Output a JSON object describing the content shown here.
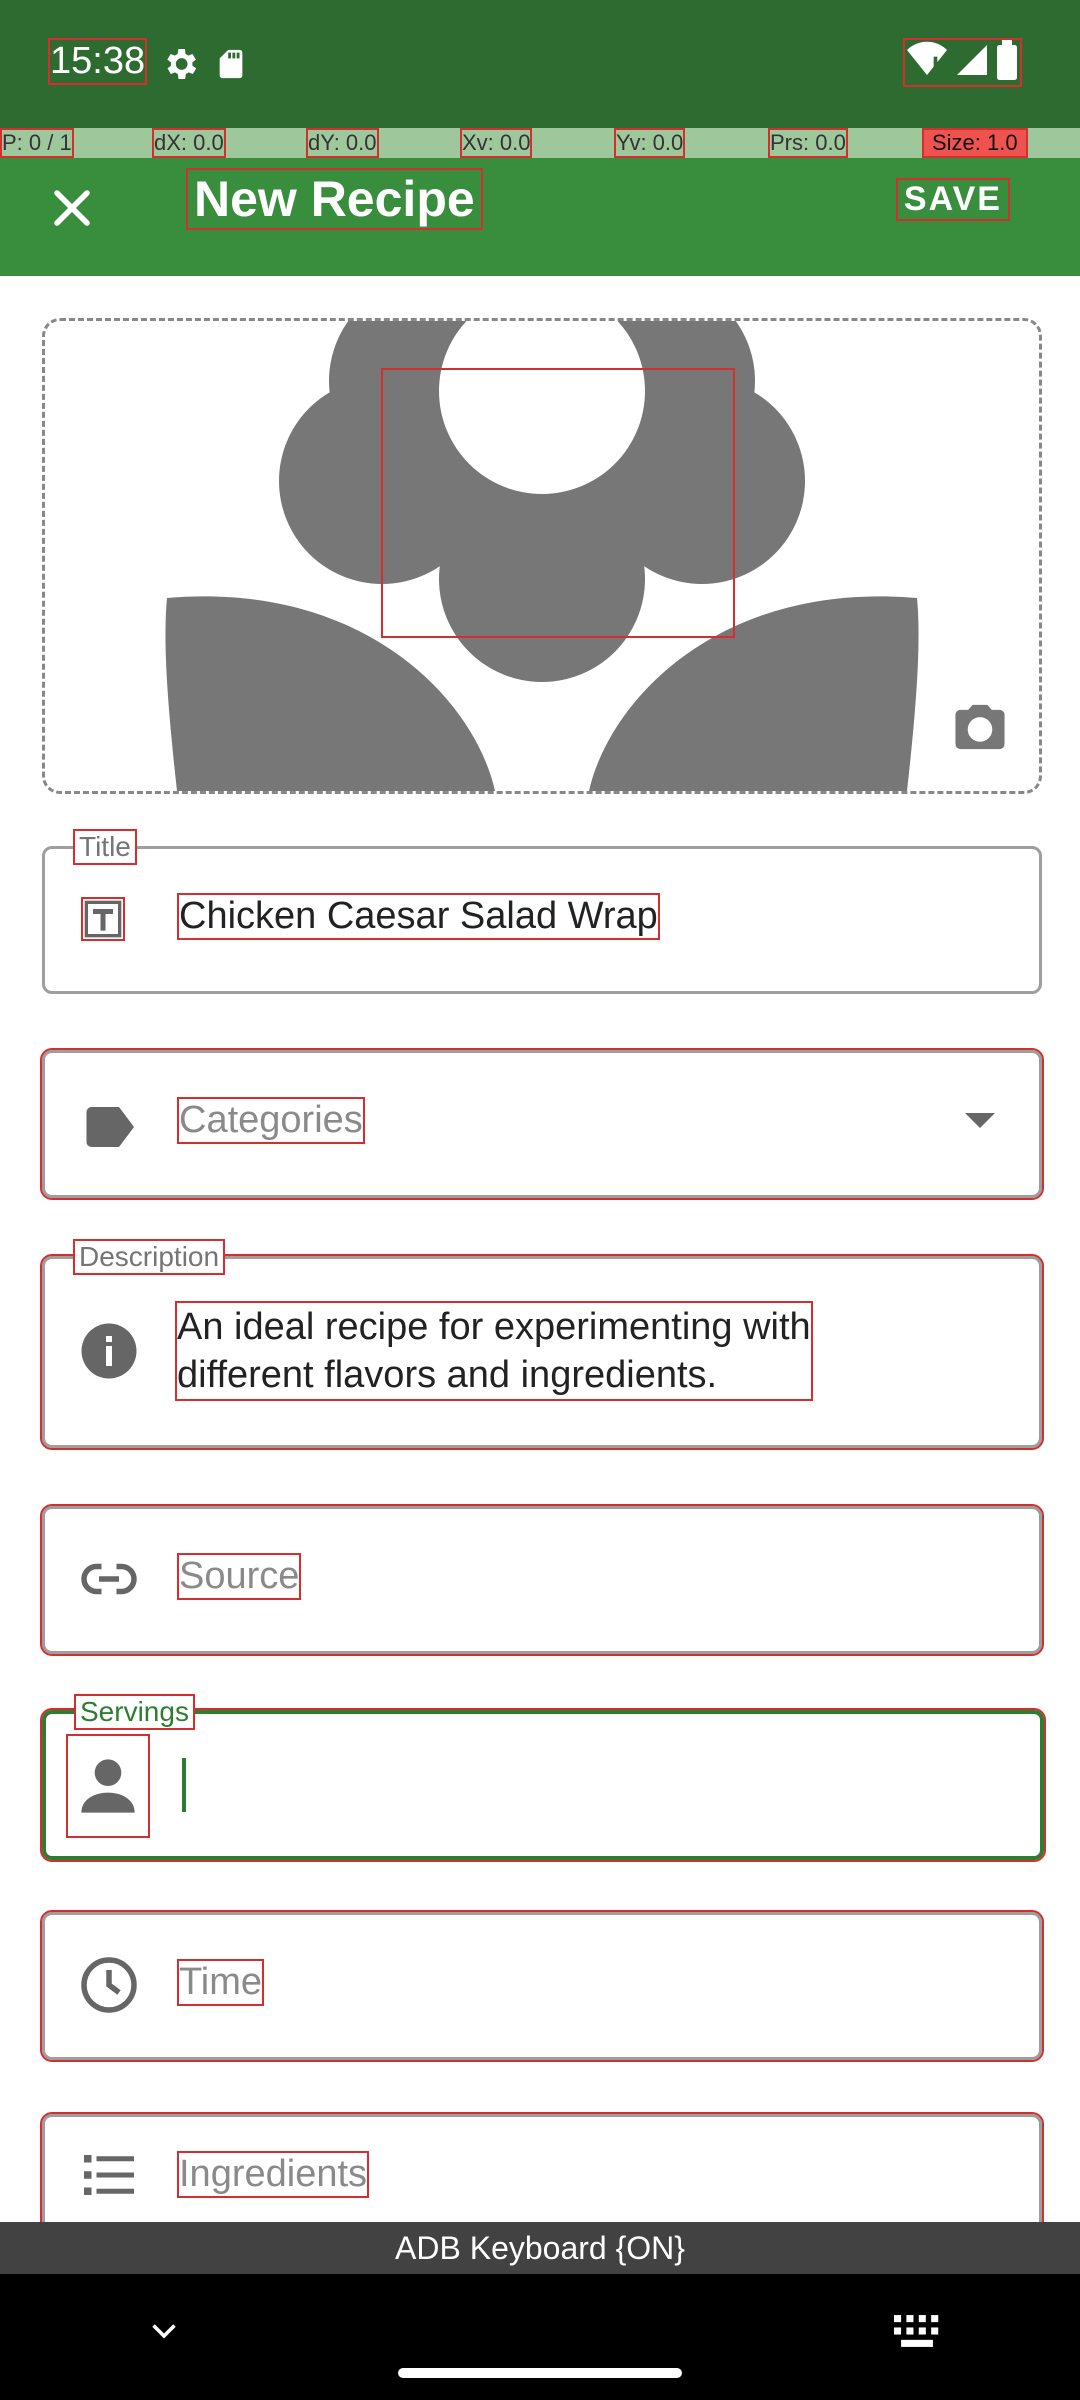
{
  "status_bar": {
    "time": "15:38",
    "left_icons": [
      "settings-icon",
      "sd-card-icon"
    ],
    "right_icons": [
      "wifi-alert-icon",
      "signal-icon",
      "battery-icon"
    ]
  },
  "dev_overlay": {
    "p": "P: 0 / 1",
    "dx": "dX: 0.0",
    "dy": "dY: 0.0",
    "xv": "Xv: 0.0",
    "yv": "Yv: 0.0",
    "prs": "Prs: 0.0",
    "size": "Size: 1.0"
  },
  "app_bar": {
    "title": "New Recipe",
    "save_label": "SAVE",
    "close_icon": "close-icon",
    "color": "#388e3c"
  },
  "form": {
    "title": {
      "label": "Title",
      "value": "Chicken Caesar Salad Wrap"
    },
    "categories": {
      "placeholder": "Categories"
    },
    "description": {
      "label": "Description",
      "value_line1": "An ideal recipe for experimenting with",
      "value_line2": "different flavors and ingredients."
    },
    "source": {
      "placeholder": "Source"
    },
    "servings": {
      "label": "Servings",
      "value": ""
    },
    "time": {
      "placeholder": "Time"
    },
    "ingredients": {
      "placeholder": "Ingredients"
    }
  },
  "keyboard_bar": {
    "text": "ADB Keyboard {ON}"
  },
  "colors": {
    "status_bar": "#2e6b30",
    "accent": "#2e7d32",
    "image_placeholder": "#777777"
  }
}
